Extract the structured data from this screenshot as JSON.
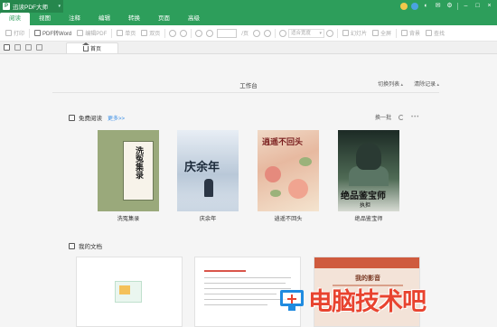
{
  "app": {
    "title": "迅读PDF大师"
  },
  "menu": [
    {
      "label": "阅读",
      "active": true
    },
    {
      "label": "视图"
    },
    {
      "label": "注释"
    },
    {
      "label": "编辑"
    },
    {
      "label": "转换"
    },
    {
      "label": "页面"
    },
    {
      "label": "高级"
    }
  ],
  "toolbar": {
    "print": "打印",
    "pdf_to_word": "PDF转Word",
    "edit_pdf": "编辑PDF",
    "single_page": "单页",
    "double_page": "双页",
    "page_suffix": "/页",
    "zoom": "适合宽度",
    "slideshow": "幻灯片",
    "fullscreen": "全屏",
    "background": "背景",
    "search": "查找"
  },
  "tabs": {
    "home": "首页"
  },
  "workbench": {
    "title": "工作台",
    "switch_list": "切换列表",
    "clear_history": "清除记录"
  },
  "free_reading": {
    "title": "免费阅读",
    "more": "更多>>",
    "refresh": "换一批",
    "books": [
      {
        "title": "洗冤集录",
        "cover_text": "洗冤集录"
      },
      {
        "title": "庆余年",
        "cover_text": "庆余年"
      },
      {
        "title": "逍遥不回头",
        "cover_text": "逍遥不回头"
      },
      {
        "title": "绝品鉴宝师",
        "cover_text": "绝品鉴宝师",
        "cover_author": "执担"
      }
    ]
  },
  "my_docs": {
    "title": "我的文档",
    "cards": [
      {
        "kind": "blank"
      },
      {
        "kind": "text"
      },
      {
        "kind": "banner",
        "heading": "我的影音"
      }
    ]
  },
  "watermark": {
    "text": "电脑技术吧"
  },
  "colors": {
    "brand": "#2d9e5b",
    "link": "#3a8ee6",
    "watermark_red": "#e8432f",
    "watermark_blue": "#1f8be0"
  }
}
